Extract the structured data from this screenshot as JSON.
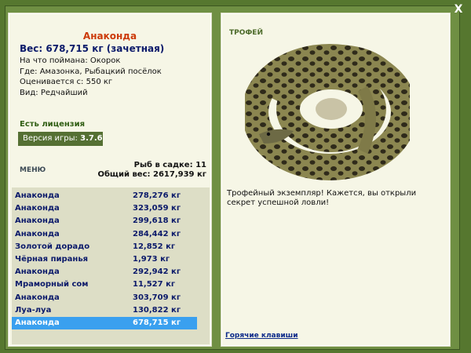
{
  "window": {
    "close_label": "X"
  },
  "fish": {
    "name": "Анаконда",
    "weight": "Вес: 678,715 кг (зачетная)",
    "bait": "На что поймана: Окорок",
    "location": "Где: Амазонка, Рыбацкий посёлок",
    "valued": "Оценивается с: 550 кг",
    "kind": "Вид: Редчайший"
  },
  "license": "Есть лицензия",
  "version": {
    "label": "Версия игры:",
    "value": "3.7.6"
  },
  "menu_label": "МЕНЮ",
  "stats": {
    "count": "Рыб в садке: 11",
    "total": "Общий вес: 2617,939 кг"
  },
  "catch_list": [
    {
      "name": "Анаконда",
      "weight": "278,276 кг"
    },
    {
      "name": "Анаконда",
      "weight": "323,059 кг"
    },
    {
      "name": "Анаконда",
      "weight": "299,618 кг"
    },
    {
      "name": "Анаконда",
      "weight": "284,442 кг"
    },
    {
      "name": "Золотой дорадо",
      "weight": "12,852 кг"
    },
    {
      "name": "Чёрная пиранья",
      "weight": "1,973 кг"
    },
    {
      "name": "Анаконда",
      "weight": "292,942 кг"
    },
    {
      "name": "Мраморный сом",
      "weight": "11,527 кг"
    },
    {
      "name": "Анаконда",
      "weight": "303,709 кг"
    },
    {
      "name": "Луа-луа",
      "weight": "130,822 кг"
    },
    {
      "name": "Анаконда",
      "weight": "678,715 кг"
    }
  ],
  "selected_index": 10,
  "trophy": {
    "label": "ТРОФЕЙ",
    "description": "Трофейный экземпляр! Кажется, вы открыли секрет успешной ловли!"
  },
  "hotkeys": "Горячие клавиши",
  "colors": {
    "background": "#56772f",
    "panel": "#f6f6e6",
    "selected": "#3aa0ef",
    "title": "#cc3a0a"
  }
}
